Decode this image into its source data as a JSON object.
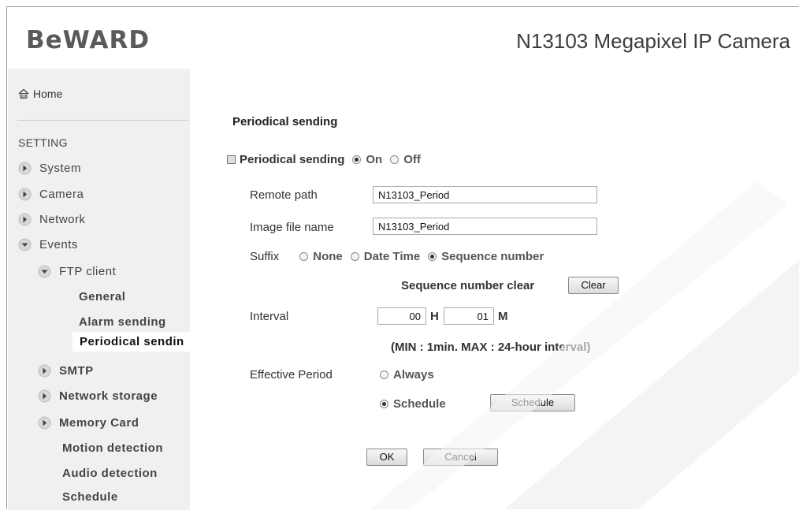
{
  "header": {
    "logo": "BeWARD",
    "model_title": "N13103 Megapixel IP Camera"
  },
  "sidebar": {
    "home_label": "Home",
    "setting_label": "SETTING",
    "items": [
      {
        "label": "System"
      },
      {
        "label": "Camera"
      },
      {
        "label": "Network"
      },
      {
        "label": "Events"
      },
      {
        "label": "FTP client"
      },
      {
        "label": "General"
      },
      {
        "label": "Alarm sending"
      },
      {
        "label": "Periodical sendin"
      },
      {
        "label": "SMTP"
      },
      {
        "label": "Network storage"
      },
      {
        "label": "Memory Card"
      },
      {
        "label": "Motion detection"
      },
      {
        "label": "Audio detection"
      },
      {
        "label": "Schedule"
      }
    ]
  },
  "main": {
    "section_title": "Periodical sending",
    "enable": {
      "label": "Periodical sending",
      "on_label": "On",
      "off_label": "Off",
      "selected": "On"
    },
    "remote_path": {
      "label": "Remote path",
      "value": "N13103_Period"
    },
    "image_file_name": {
      "label": "Image file name",
      "value": "N13103_Period"
    },
    "suffix": {
      "label": "Suffix",
      "options": [
        "None",
        "Date Time",
        "Sequence number"
      ],
      "selected": "Sequence number"
    },
    "sequence_clear": {
      "label": "Sequence number clear",
      "button": "Clear"
    },
    "interval": {
      "label": "Interval",
      "hours": "00",
      "hours_unit": "H",
      "minutes": "01",
      "minutes_unit": "M",
      "note": "(MIN : 1min. MAX : 24-hour interval)"
    },
    "effective_period": {
      "label": "Effective Period",
      "always_label": "Always",
      "schedule_label": "Schedule",
      "selected": "Schedule",
      "schedule_button": "Schedule"
    },
    "ok_button": "OK",
    "cancel_button": "Cancel"
  },
  "colors": {
    "sidebar_bg": "#f0f0f0",
    "logo": "#5a5a5a",
    "text": "#333333"
  }
}
